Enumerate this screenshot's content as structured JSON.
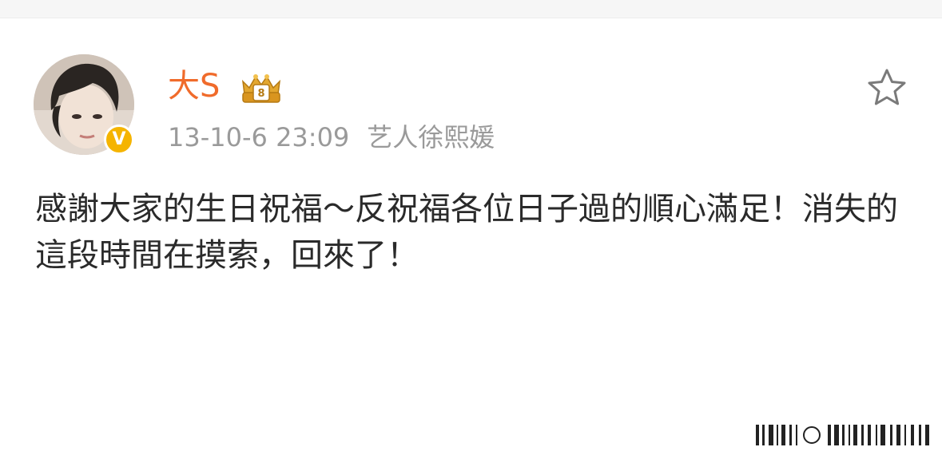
{
  "post": {
    "author": {
      "name": "大S",
      "verified": true,
      "verified_color": "#f5b400",
      "avatar_icon": "user-avatar-photo"
    },
    "badge_icon": "gold-crown-fan-badge-icon",
    "timestamp": "13-10-6 23:09",
    "source": "艺人徐熙媛",
    "text": "感謝大家的生日祝福～反祝福各位日子過的順心滿足！消失的這段時間在摸索，回來了！",
    "favorite_icon": "star-outline-icon"
  },
  "colors": {
    "username": "#f06b2b",
    "meta": "#9a9a9a",
    "body_text": "#2a2a2a",
    "background": "#ffffff"
  }
}
